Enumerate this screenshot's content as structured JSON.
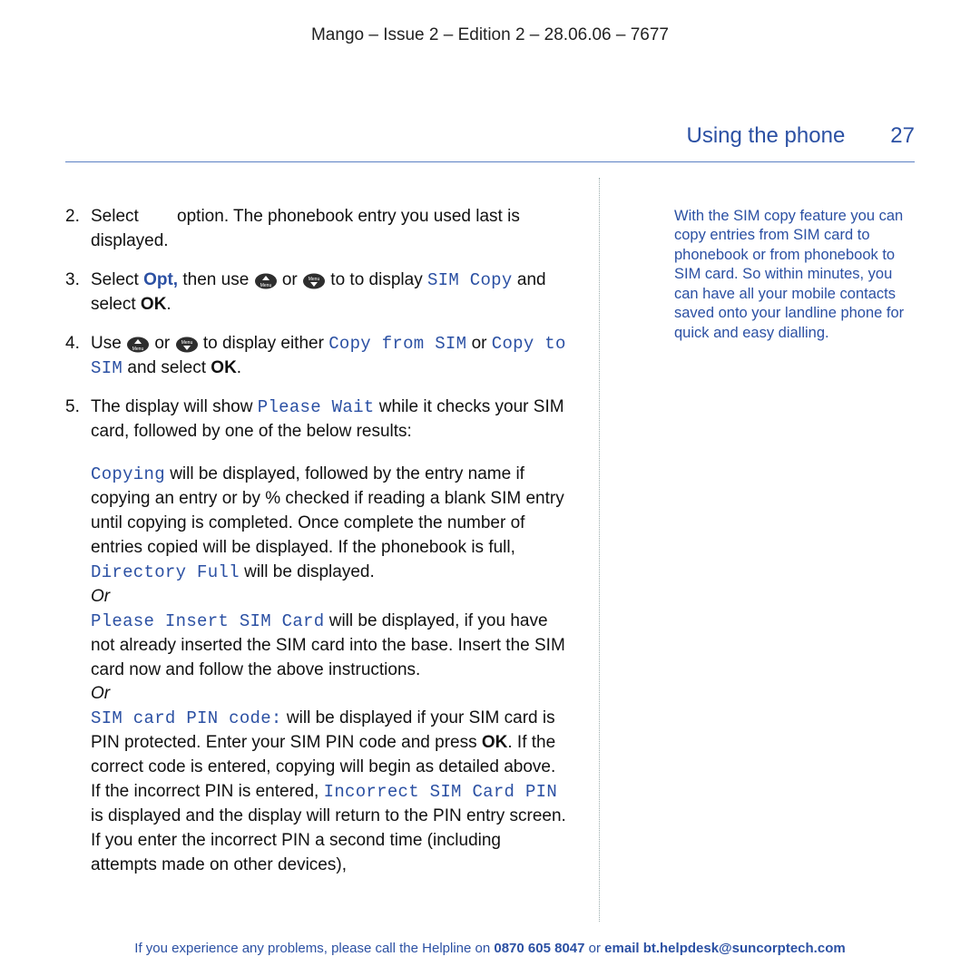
{
  "header": {
    "doc_id": "Mango – Issue 2 – Edition 2 – 28.06.06 – 7677",
    "section_title": "Using the phone",
    "page_number": "27"
  },
  "steps": [
    {
      "num": "2.",
      "a": "Select",
      "b": "option. The phonebook entry you used last is displayed."
    },
    {
      "num": "3.",
      "a": "Select ",
      "opt": "Opt,",
      "b": " then use ",
      "c": " or ",
      "d": " to to display ",
      "lcd1": "SIM Copy",
      "e": " and select ",
      "ok": "OK",
      "f": "."
    },
    {
      "num": "4.",
      "a": "Use ",
      "b": " or ",
      "c": " to display either ",
      "lcd1": "Copy from SIM",
      "d": " or ",
      "lcd2": "Copy to SIM",
      "e": " and select ",
      "ok": "OK",
      "f": "."
    },
    {
      "num": "5.",
      "a": " The display will show ",
      "lcd1": "Please Wait",
      "b": " while it checks your SIM card, followed by one of the below results:"
    }
  ],
  "results": {
    "or": "Or",
    "copying": {
      "lcd": "Copying",
      "a": " will be displayed, followed by the entry name if copying an entry or by % checked if reading a blank SIM entry until copying is completed. Once complete the number of entries copied will be displayed. If the phonebook is full, ",
      "lcd2": "Directory Full",
      "b": " will be displayed."
    },
    "insert": {
      "lcd": "Please Insert SIM Card",
      "a": " will be displayed, if you have not already inserted the SIM card into the  base. Insert the SIM card now and follow the above instructions."
    },
    "pin": {
      "lcd": "SIM card PIN code:",
      "a": " will be displayed if your SIM card is PIN protected.  Enter your SIM PIN code and press ",
      "ok": "OK",
      "b": ". If the correct code is entered, copying will begin as detailed above. If the incorrect PIN is entered, ",
      "lcd2": "Incorrect SIM Card PIN",
      "c": " is displayed and the display will return to the PIN entry screen. If you enter the incorrect PIN a second time (including attempts made on other devices),"
    }
  },
  "sidebar": {
    "note": "With the SIM copy feature you can copy entries from SIM card to phonebook or from phonebook to SIM card. So within minutes, you can have all your mobile contacts saved onto your landline phone for quick and easy dialling."
  },
  "footer": {
    "a": "If you experience any problems, please call the Helpline on ",
    "phone": "0870 605 8047",
    "b": " or ",
    "email": "email bt.helpdesk@suncorptech.com"
  }
}
